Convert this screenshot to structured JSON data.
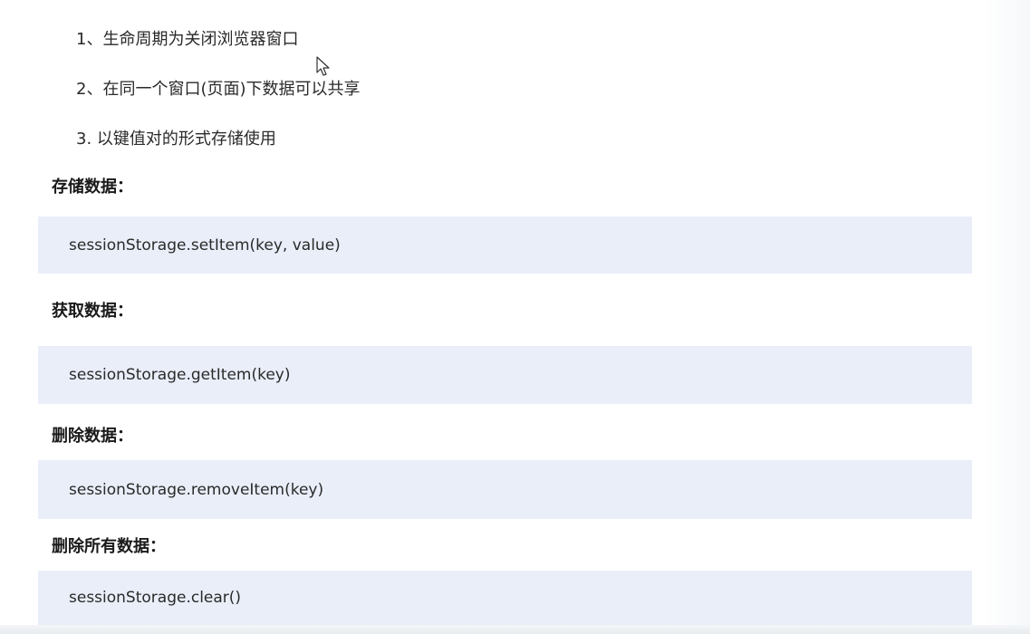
{
  "list": [
    "1、生命周期为关闭浏览器窗口",
    "2、在同一个窗口(页面)下数据可以共享",
    "3.  以键值对的形式存储使用"
  ],
  "sections": [
    {
      "heading": "存储数据：",
      "code": "sessionStorage.setItem(key, value)"
    },
    {
      "heading": "获取数据：",
      "code": "sessionStorage.getItem(key)"
    },
    {
      "heading": "删除数据：",
      "code": "sessionStorage.removeItem(key)"
    },
    {
      "heading": "删除所有数据：",
      "code": "sessionStorage.clear()"
    }
  ],
  "colors": {
    "code_background": "#e9eef9",
    "text": "#2a2a2a"
  },
  "icons": {
    "cursor": "mouse-pointer-icon"
  }
}
